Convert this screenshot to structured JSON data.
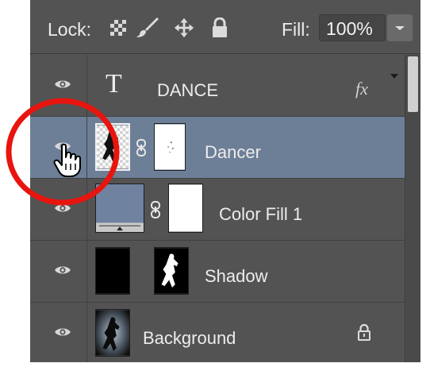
{
  "lockbar": {
    "lock_label": "Lock:",
    "icons": [
      "lock-transparent-pixels-icon",
      "lock-image-pixels-icon",
      "lock-position-icon",
      "lock-all-icon"
    ],
    "fill_label": "Fill:",
    "fill_value": "100%"
  },
  "layers": [
    {
      "name": "DANCE",
      "type": "text",
      "thumb_glyph": "T",
      "fx_label": "fx",
      "selected": false
    },
    {
      "name": "Dancer",
      "type": "image-with-mask",
      "selected": true
    },
    {
      "name": "Color Fill 1",
      "type": "fill-with-mask",
      "fill_color": "#6f82a0",
      "selected": false
    },
    {
      "name": "Shadow",
      "type": "image-with-mask",
      "selected": false
    },
    {
      "name": "Background",
      "type": "image-locked",
      "selected": false
    }
  ],
  "colors": {
    "panel_bg": "#535353",
    "selected_row": "#6d7f97",
    "annotation_red": "#e8150f"
  }
}
